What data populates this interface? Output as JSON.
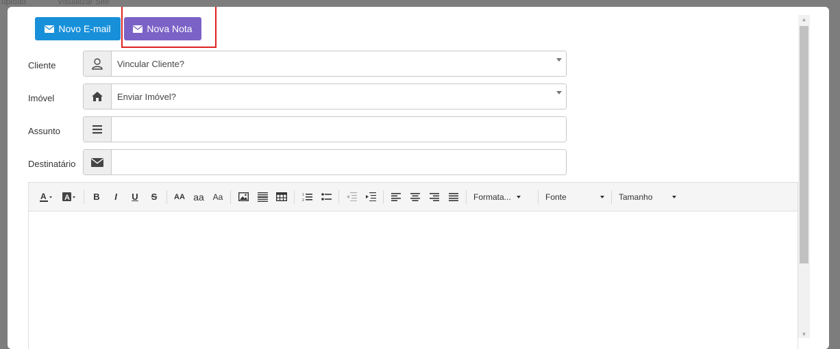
{
  "backdrop": {
    "top_left_text": "upload",
    "top_mid_text": "Visualizar Site"
  },
  "actions": {
    "new_email_label": "Novo E-mail",
    "new_note_label": "Nova Nota"
  },
  "form": {
    "cliente": {
      "label": "Cliente",
      "value": "Vincular Cliente?",
      "icon": "user-icon"
    },
    "imovel": {
      "label": "Imóvel",
      "value": "Enviar Imóvel?",
      "icon": "home-icon"
    },
    "assunto": {
      "label": "Assunto",
      "value": "",
      "icon": "list-icon"
    },
    "destinatario": {
      "label": "Destinatário",
      "value": "",
      "icon": "envelope-icon"
    }
  },
  "toolbar": {
    "bold": "B",
    "italic": "I",
    "underline": "U",
    "strike": "S",
    "uppercase": "AA",
    "lowercase": "aa",
    "capitalize": "Aa",
    "format_label": "Formata...",
    "font_label": "Fonte",
    "size_label": "Tamanho"
  },
  "colors": {
    "email_button": "#1890d9",
    "note_button": "#7b62c6",
    "highlight": "#e02020"
  }
}
